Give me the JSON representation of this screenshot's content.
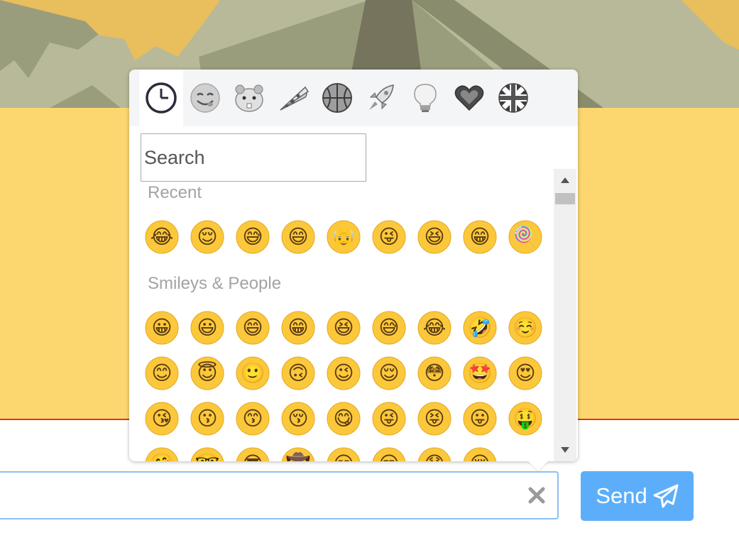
{
  "picker": {
    "categories": [
      {
        "id": "recent",
        "icon": "clock-icon",
        "active": true
      },
      {
        "id": "smileys",
        "icon": "smiley-face-icon",
        "active": false
      },
      {
        "id": "animals",
        "icon": "hamster-icon",
        "active": false
      },
      {
        "id": "food",
        "icon": "pizza-icon",
        "active": false
      },
      {
        "id": "activities",
        "icon": "basketball-icon",
        "active": false
      },
      {
        "id": "travel",
        "icon": "rocket-icon",
        "active": false
      },
      {
        "id": "objects",
        "icon": "lightbulb-icon",
        "active": false
      },
      {
        "id": "symbols",
        "icon": "heart-icon",
        "active": false
      },
      {
        "id": "flags",
        "icon": "flag-icon",
        "active": false
      }
    ],
    "search": {
      "placeholder": "Search",
      "value": ""
    },
    "sections": [
      {
        "title": "Recent",
        "emojis": [
          "😂",
          "😌",
          "😅",
          "😄",
          "👴",
          "😜",
          "😆",
          "😁",
          "🍭"
        ]
      },
      {
        "title": "Smileys & People",
        "emojis": [
          "😀",
          "😃",
          "😄",
          "😁",
          "😆",
          "😅",
          "😂",
          "🤣",
          "☺️",
          "😊",
          "😇",
          "🙂",
          "🙃",
          "😉",
          "😌",
          "😳",
          "🤩",
          "😍",
          "😘",
          "😗",
          "😙",
          "😚",
          "😋",
          "😜",
          "😝",
          "😛",
          "🤑",
          "🤗",
          "🤓",
          "😎",
          "🤠",
          "😏",
          "😒",
          "😞",
          "😔"
        ]
      }
    ]
  },
  "composer": {
    "message": {
      "placeholder": "",
      "value": ""
    },
    "send_label": "Send"
  },
  "colors": {
    "accent": "#5caefa",
    "input_border": "#8cc0f2",
    "scene_yellow": "#fcd76f",
    "scene_green": "#9a9d7c",
    "divider_red": "#d23a2a"
  }
}
